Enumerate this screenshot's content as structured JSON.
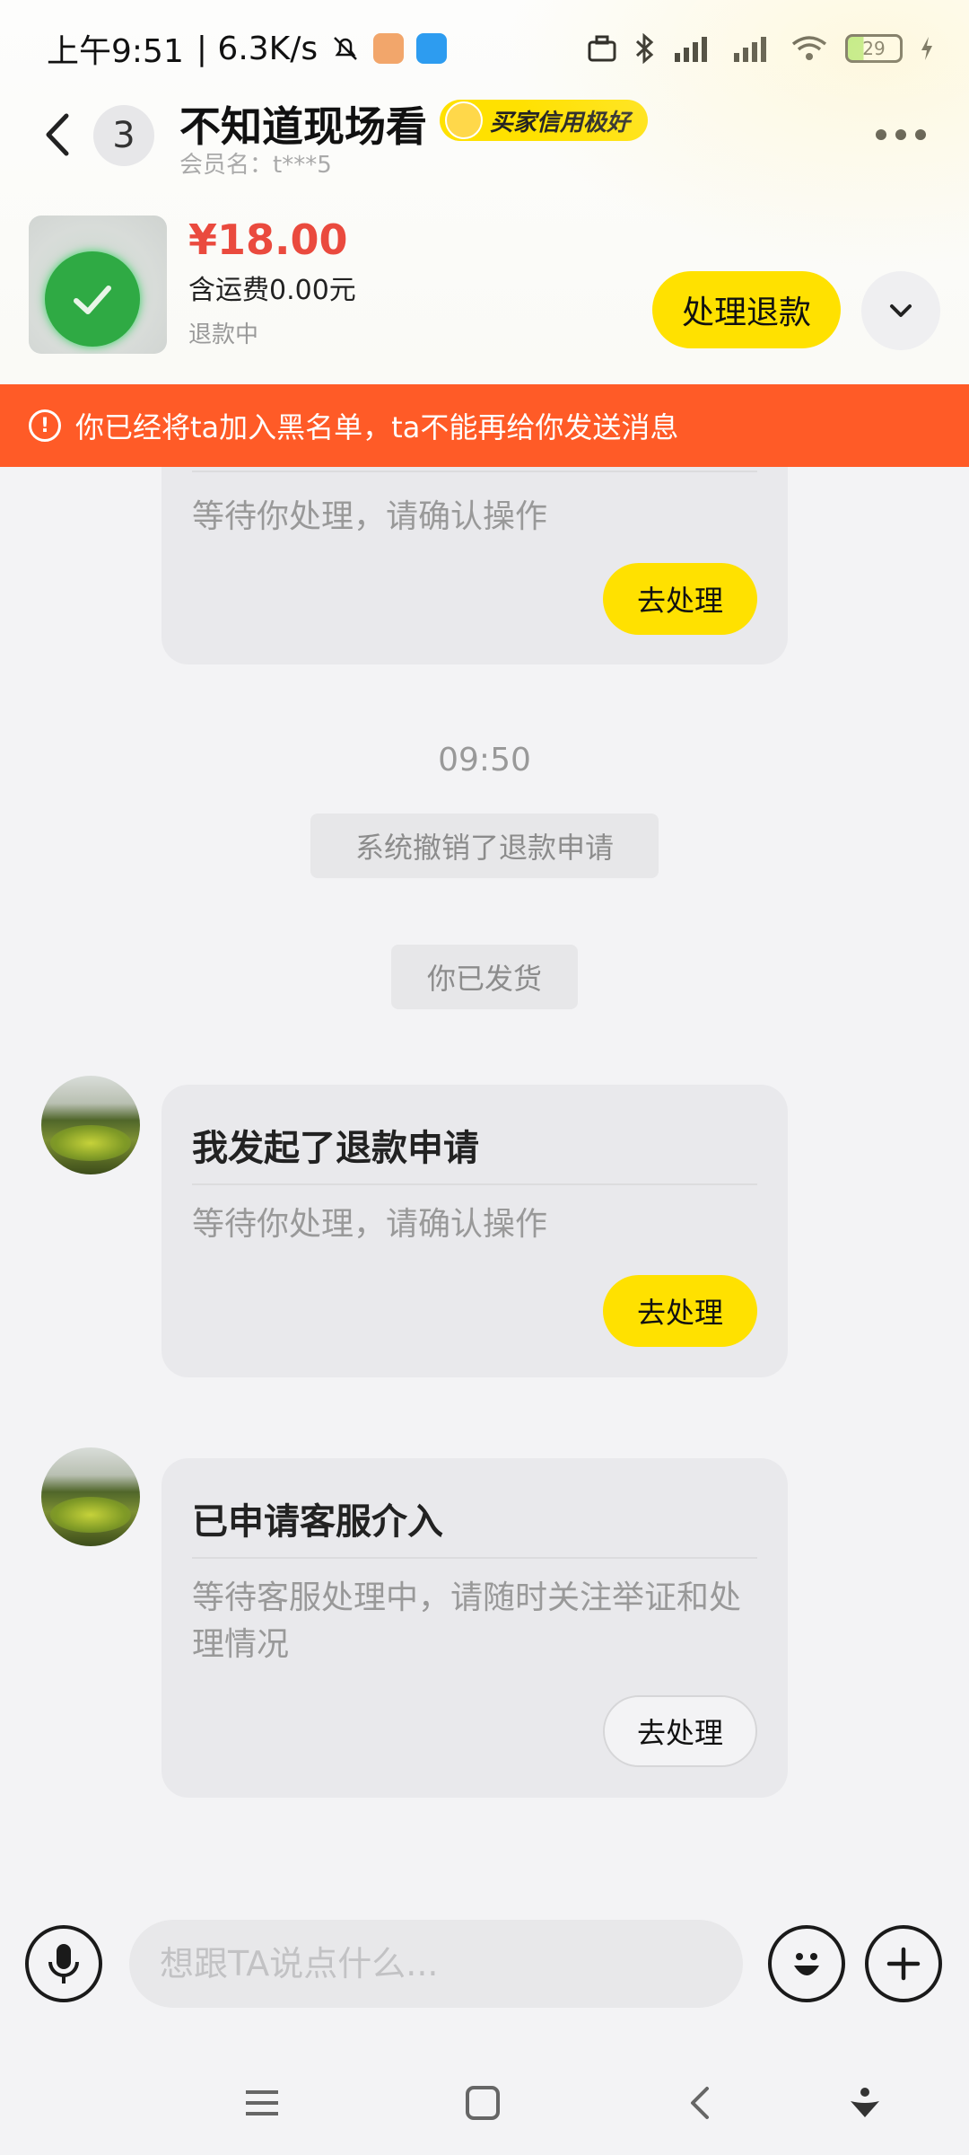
{
  "status_bar": {
    "time": "上午9:51",
    "net_speed": "| 6.3K/s",
    "battery": "29"
  },
  "header": {
    "unread_count": "3",
    "title": "不知道现场看",
    "credit_badge": "买家信用极好",
    "member_name": "会员名：t***5"
  },
  "product": {
    "price": "¥18.00",
    "shipping": "含运费0.00元",
    "status": "退款中",
    "refund_button": "处理退款"
  },
  "banner": {
    "text": "你已经将ta加入黑名单，ta不能再给你发送消息"
  },
  "messages": {
    "partial_card": {
      "desc": "等待你处理，请确认操作",
      "button": "去处理"
    },
    "timestamp": "09:50",
    "system_1": "系统撤销了退款申请",
    "system_2": "你已发货",
    "refund_card": {
      "title": "我发起了退款申请",
      "desc": "等待你处理，请确认操作",
      "button": "去处理"
    },
    "service_card": {
      "title": "已申请客服介入",
      "desc": "等待客服处理中，请随时关注举证和处理情况",
      "button": "去处理"
    }
  },
  "input": {
    "placeholder": "想跟TA说点什么..."
  },
  "icons": {
    "back": "back-arrow-icon",
    "more": "more-dots-icon",
    "expand": "chevron-down-icon",
    "voice": "microphone-icon",
    "emoji": "emoji-icon",
    "plus": "plus-icon",
    "warning": "alert-circle-icon"
  },
  "colors": {
    "accent_yellow": "#ffe100",
    "banner_orange": "#ff5b27",
    "price_red": "#ea4a3e"
  }
}
